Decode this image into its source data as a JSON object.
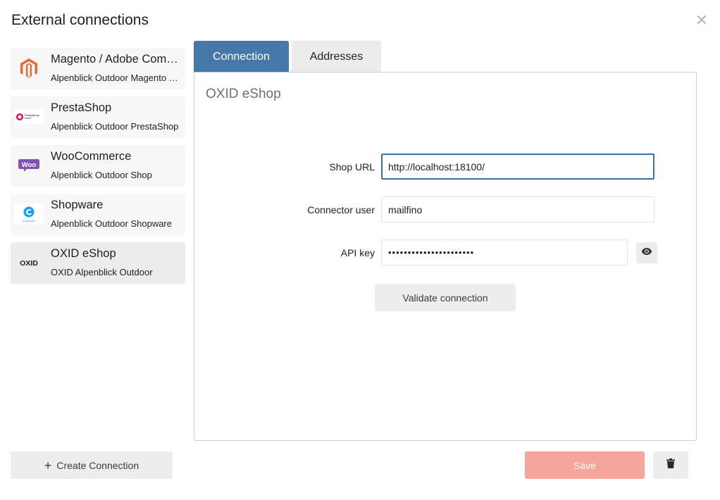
{
  "dialog": {
    "title": "External connections",
    "close_icon": "close-icon"
  },
  "sidebar": {
    "items": [
      {
        "name": "Magento / Adobe Commerce",
        "subtitle": "Alpenblick Outdoor Magento Shop",
        "icon": "magento-logo",
        "active": false
      },
      {
        "name": "PrestaShop",
        "subtitle": "Alpenblick Outdoor PrestaShop",
        "icon": "prestashop-logo",
        "logo_text": "PrestaShop",
        "active": false
      },
      {
        "name": "WooCommerce",
        "subtitle": "Alpenblick Outdoor Shop",
        "icon": "woocommerce-logo",
        "logo_text": "Woo",
        "active": false
      },
      {
        "name": "Shopware",
        "subtitle": "Alpenblick Outdoor Shopware",
        "icon": "shopware-logo",
        "logo_text": "shopware",
        "active": false
      },
      {
        "name": "OXID eShop",
        "subtitle": "OXID Alpenblick Outdoor",
        "icon": "oxid-logo",
        "logo_text": "OXID",
        "active": true
      }
    ]
  },
  "tabs": [
    {
      "label": "Connection",
      "active": true
    },
    {
      "label": "Addresses",
      "active": false
    }
  ],
  "panel": {
    "title": "OXID eShop",
    "shop_url": {
      "label": "Shop URL",
      "value": "http://localhost:18100/"
    },
    "connector_user": {
      "label": "Connector user",
      "value": "mailfino"
    },
    "api_key": {
      "label": "API key",
      "value": "••••••••••••••••••••••",
      "toggle_icon": "eye-icon"
    },
    "validate_label": "Validate connection"
  },
  "footer": {
    "create_label": "Create Connection",
    "create_icon": "plus-icon",
    "save_label": "Save",
    "delete_icon": "trash-icon"
  },
  "colors": {
    "accent": "#4578a8",
    "save": "#f5a59b",
    "focus_border": "#3a70a8"
  }
}
